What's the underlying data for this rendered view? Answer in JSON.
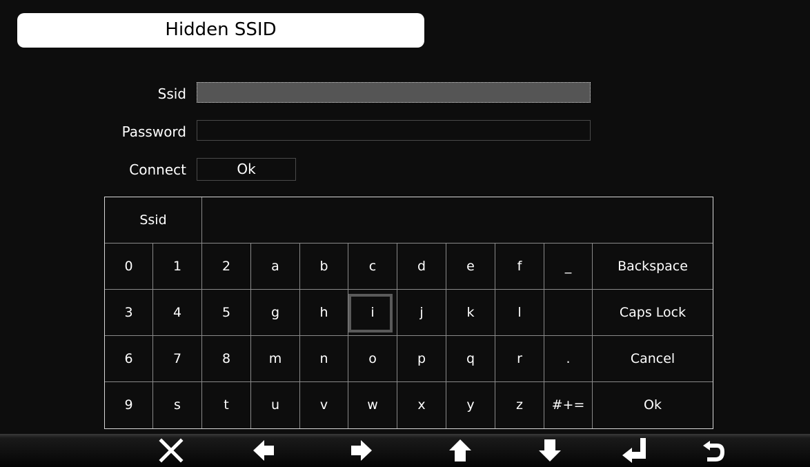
{
  "title": "Hidden SSID",
  "form": {
    "ssid_label": "Ssid",
    "ssid_value": "",
    "password_label": "Password",
    "password_value": "",
    "connect_label": "Connect",
    "ok_label": "Ok"
  },
  "keyboard": {
    "target_label": "Ssid",
    "input_value": "",
    "selected_key": "i",
    "rows": [
      [
        "0",
        "1",
        "2",
        "a",
        "b",
        "c",
        "d",
        "e",
        "f",
        "_"
      ],
      [
        "3",
        "4",
        "5",
        "g",
        "h",
        "i",
        "j",
        "k",
        "l",
        ""
      ],
      [
        "6",
        "7",
        "8",
        "m",
        "n",
        "o",
        "p",
        "q",
        "r",
        "."
      ],
      [
        "9",
        "s",
        "t",
        "u",
        "v",
        "w",
        "x",
        "y",
        "z",
        "#+="
      ]
    ],
    "actions": [
      "Backspace",
      "Caps Lock",
      "Cancel",
      "Ok"
    ]
  },
  "nav": {
    "icons": [
      "close-icon",
      "arrow-left-icon",
      "arrow-right-icon",
      "arrow-up-icon",
      "arrow-down-icon",
      "enter-icon",
      "back-icon"
    ]
  }
}
